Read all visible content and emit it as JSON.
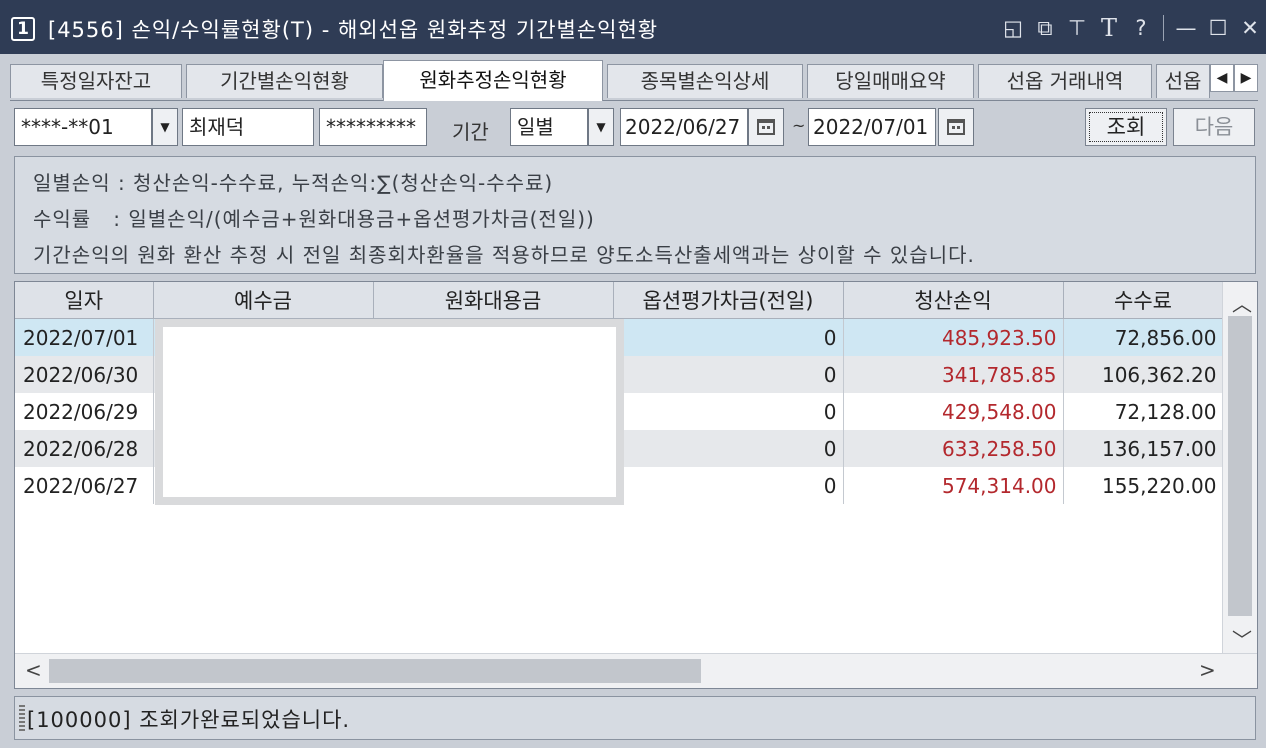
{
  "window": {
    "number": "1",
    "title": "[4556] 손익/수익률현황(T) - 해외선옵 원화추정 기간별손익현황",
    "icons": [
      "restore-small-icon",
      "copy-window-icon",
      "pin-icon",
      "font-T-icon",
      "help-icon",
      "minimize-icon",
      "maximize-icon",
      "close-icon"
    ],
    "icon_glyphs": {
      "restore": "◱",
      "copy": "⧉",
      "pin": "⊤",
      "font": "T",
      "help": "?",
      "minimize": "—",
      "maximize": "☐",
      "close": "✕"
    }
  },
  "tabs": [
    {
      "label": "특정일자잔고",
      "active": false
    },
    {
      "label": "기간별손익현황",
      "active": false
    },
    {
      "label": "원화추정손익현황",
      "active": true
    },
    {
      "label": "종목별손익상세",
      "active": false
    },
    {
      "label": "당일매매요약",
      "active": false
    },
    {
      "label": "선옵 거래내역",
      "active": false
    },
    {
      "label": "선옵",
      "active": false
    }
  ],
  "toolbar": {
    "account": "****-**01",
    "name": "최재덕",
    "password": "*********",
    "period_label": "기간",
    "period_value": "일별",
    "date_from": "2022/06/27",
    "tilde": "~",
    "date_to": "2022/07/01",
    "search_button": "조회",
    "next_button": "다음"
  },
  "info": {
    "line1": "일별손익 : 청산손익-수수료, 누적손익:∑(청산손익-수수료)",
    "line2": "수익률   : 일별손익/(예수금+원화대용금+옵션평가차금(전일))",
    "line3": "기간손익의 원화 환산 추정 시 전일 최종회차환율을 적용하므로 양도소득산출세액과는 상이할 수 있습니다."
  },
  "grid": {
    "columns": [
      "일자",
      "예수금",
      "원화대용금",
      "옵션평가차금(전일)",
      "청산손익",
      "수수료"
    ],
    "rows": [
      {
        "date": "2022/07/01",
        "option_eval": "0",
        "settle_pl": "485,923.50",
        "fee": "72,856.00"
      },
      {
        "date": "2022/06/30",
        "option_eval": "0",
        "settle_pl": "341,785.85",
        "fee": "106,362.20"
      },
      {
        "date": "2022/06/29",
        "option_eval": "0",
        "settle_pl": "429,548.00",
        "fee": "72,128.00"
      },
      {
        "date": "2022/06/28",
        "option_eval": "0",
        "settle_pl": "633,258.50",
        "fee": "136,157.00"
      },
      {
        "date": "2022/06/27",
        "option_eval": "0",
        "settle_pl": "574,314.00",
        "fee": "155,220.00"
      }
    ]
  },
  "status": {
    "message": "[100000] 조회가완료되었습니다."
  },
  "colors": {
    "title_bg": "#2f3c55",
    "selected_row": "#cfe7f3",
    "profit_red": "#b3282d"
  }
}
